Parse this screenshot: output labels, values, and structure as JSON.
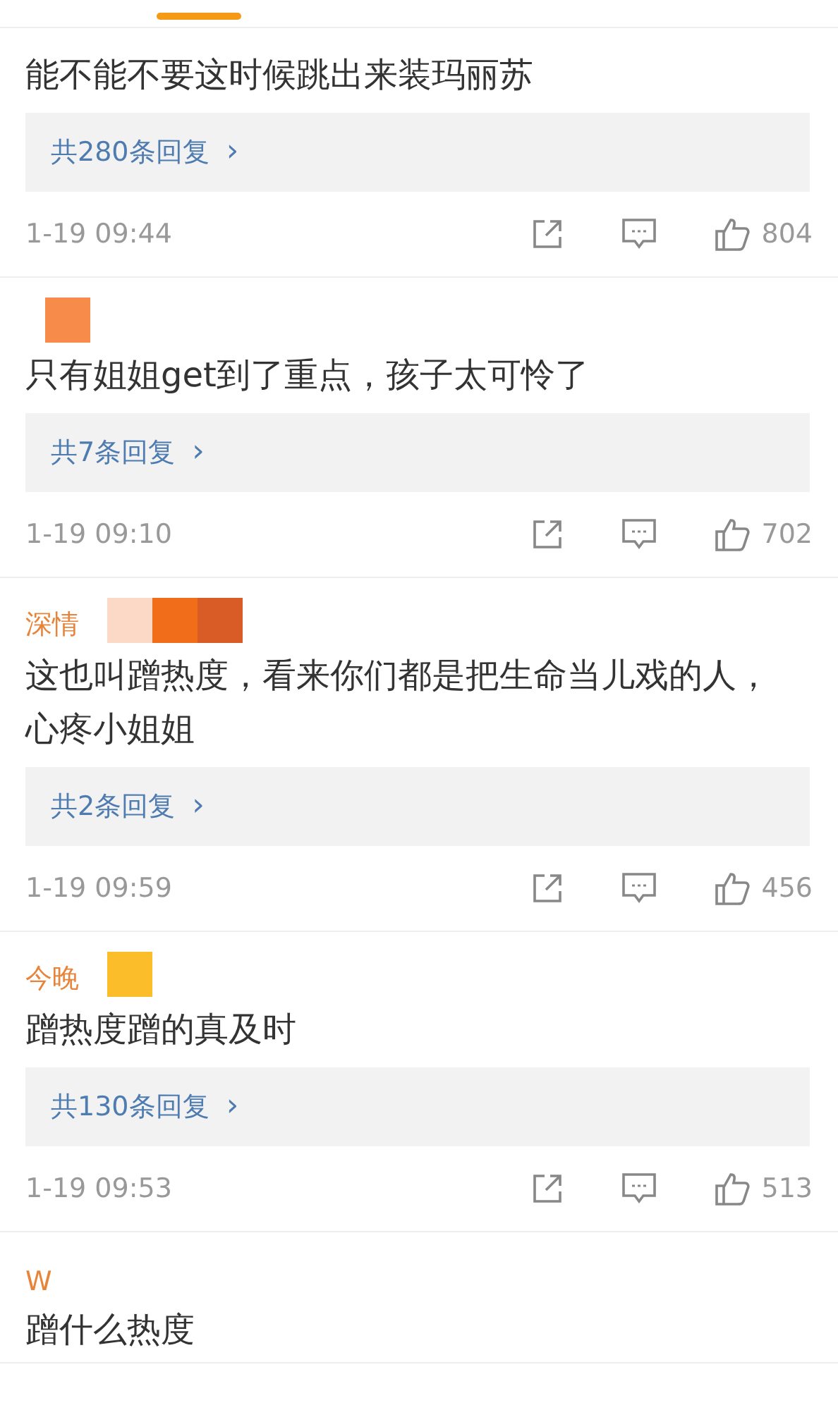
{
  "tab_indicator": {
    "selected": true
  },
  "comments": [
    {
      "text": "能不能不要这时候跳出来装玛丽苏",
      "replies": "共280条回复",
      "chevron": "›",
      "time": "1-19 09:44",
      "likes": "804"
    },
    {
      "redactions": [
        {
          "color": "#f78b4a"
        }
      ],
      "text": "只有姐姐get到了重点，孩子太可怜了",
      "replies": "共7条回复",
      "chevron": "›",
      "time": "1-19 09:10",
      "likes": "702"
    },
    {
      "redactions": [
        {
          "color": "#fbd9c6"
        },
        {
          "color": "#f26d1a"
        },
        {
          "color": "#d95b26"
        }
      ],
      "username": "深情",
      "text": "这也叫蹭热度，看来你们都是把生命当儿戏的人，心疼小姐姐",
      "replies": "共2条回复",
      "chevron": "›",
      "time": "1-19 09:59",
      "likes": "456"
    },
    {
      "redactions": [
        {
          "color": "#fcbd2a"
        }
      ],
      "username": "今晚",
      "text": "蹭热度蹭的真及时",
      "replies": "共130条回复",
      "chevron": "›",
      "time": "1-19 09:53",
      "likes": "513"
    },
    {
      "username": "W",
      "text": "蹭什么热度"
    }
  ]
}
